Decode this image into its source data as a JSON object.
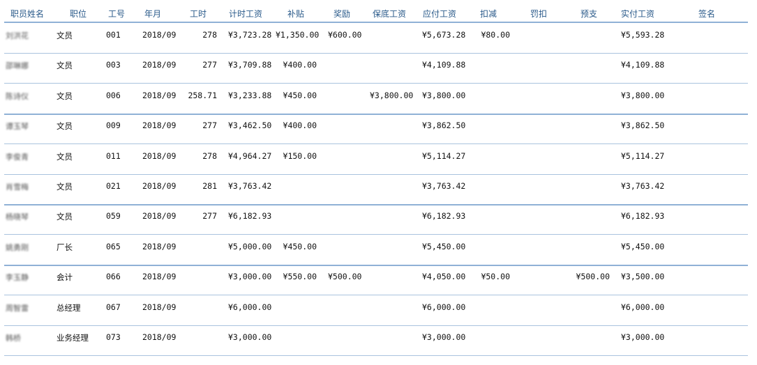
{
  "headers": {
    "name": "职员姓名",
    "position": "职位",
    "id": "工号",
    "month": "年月",
    "hours": "工时",
    "hourly_pay": "计时工资",
    "subsidy": "补贴",
    "bonus": "奖励",
    "min_wage": "保底工资",
    "payable": "应付工资",
    "deduction": "扣减",
    "fine": "罚扣",
    "advance": "预支",
    "actual": "实付工资",
    "signature": "签名"
  },
  "rows": [
    {
      "name": "刘洪花",
      "position": "文员",
      "id": "001",
      "month": "2018/09",
      "hours": "278",
      "hourly_pay": "¥3,723.28",
      "subsidy": "¥1,350.00",
      "bonus": "¥600.00",
      "min_wage": "",
      "payable": "¥5,673.28",
      "deduction": "¥80.00",
      "fine": "",
      "advance": "",
      "actual": "¥5,593.28"
    },
    {
      "name": "邵琳娜",
      "position": "文员",
      "id": "003",
      "month": "2018/09",
      "hours": "277",
      "hourly_pay": "¥3,709.88",
      "subsidy": "¥400.00",
      "bonus": "",
      "min_wage": "",
      "payable": "¥4,109.88",
      "deduction": "",
      "fine": "",
      "advance": "",
      "actual": "¥4,109.88"
    },
    {
      "name": "陈诗仪",
      "position": "文员",
      "id": "006",
      "month": "2018/09",
      "hours": "258.71",
      "hourly_pay": "¥3,233.88",
      "subsidy": "¥450.00",
      "bonus": "",
      "min_wage": "¥3,800.00",
      "payable": "¥3,800.00",
      "deduction": "",
      "fine": "",
      "advance": "",
      "actual": "¥3,800.00"
    },
    {
      "name": "谭玉琴",
      "position": "文员",
      "id": "009",
      "month": "2018/09",
      "hours": "277",
      "hourly_pay": "¥3,462.50",
      "subsidy": "¥400.00",
      "bonus": "",
      "min_wage": "",
      "payable": "¥3,862.50",
      "deduction": "",
      "fine": "",
      "advance": "",
      "actual": "¥3,862.50"
    },
    {
      "name": "李俊青",
      "position": "文员",
      "id": "011",
      "month": "2018/09",
      "hours": "278",
      "hourly_pay": "¥4,964.27",
      "subsidy": "¥150.00",
      "bonus": "",
      "min_wage": "",
      "payable": "¥5,114.27",
      "deduction": "",
      "fine": "",
      "advance": "",
      "actual": "¥5,114.27"
    },
    {
      "name": "肖雪梅",
      "position": "文员",
      "id": "021",
      "month": "2018/09",
      "hours": "281",
      "hourly_pay": "¥3,763.42",
      "subsidy": "",
      "bonus": "",
      "min_wage": "",
      "payable": "¥3,763.42",
      "deduction": "",
      "fine": "",
      "advance": "",
      "actual": "¥3,763.42"
    },
    {
      "name": "杨晓琴",
      "position": "文员",
      "id": "059",
      "month": "2018/09",
      "hours": "277",
      "hourly_pay": "¥6,182.93",
      "subsidy": "",
      "bonus": "",
      "min_wage": "",
      "payable": "¥6,182.93",
      "deduction": "",
      "fine": "",
      "advance": "",
      "actual": "¥6,182.93"
    },
    {
      "name": "姚勇刚",
      "position": "厂长",
      "id": "065",
      "month": "2018/09",
      "hours": "",
      "hourly_pay": "¥5,000.00",
      "subsidy": "¥450.00",
      "bonus": "",
      "min_wage": "",
      "payable": "¥5,450.00",
      "deduction": "",
      "fine": "",
      "advance": "",
      "actual": "¥5,450.00"
    },
    {
      "name": "李玉静",
      "position": "会计",
      "id": "066",
      "month": "2018/09",
      "hours": "",
      "hourly_pay": "¥3,000.00",
      "subsidy": "¥550.00",
      "bonus": "¥500.00",
      "min_wage": "",
      "payable": "¥4,050.00",
      "deduction": "¥50.00",
      "fine": "",
      "advance": "¥500.00",
      "actual": "¥3,500.00"
    },
    {
      "name": "周智雷",
      "position": "总经理",
      "id": "067",
      "month": "2018/09",
      "hours": "",
      "hourly_pay": "¥6,000.00",
      "subsidy": "",
      "bonus": "",
      "min_wage": "",
      "payable": "¥6,000.00",
      "deduction": "",
      "fine": "",
      "advance": "",
      "actual": "¥6,000.00"
    },
    {
      "name": "韩桥",
      "position": "业务经理",
      "id": "073",
      "month": "2018/09",
      "hours": "",
      "hourly_pay": "¥3,000.00",
      "subsidy": "",
      "bonus": "",
      "min_wage": "",
      "payable": "¥3,000.00",
      "deduction": "",
      "fine": "",
      "advance": "",
      "actual": "¥3,000.00"
    }
  ]
}
